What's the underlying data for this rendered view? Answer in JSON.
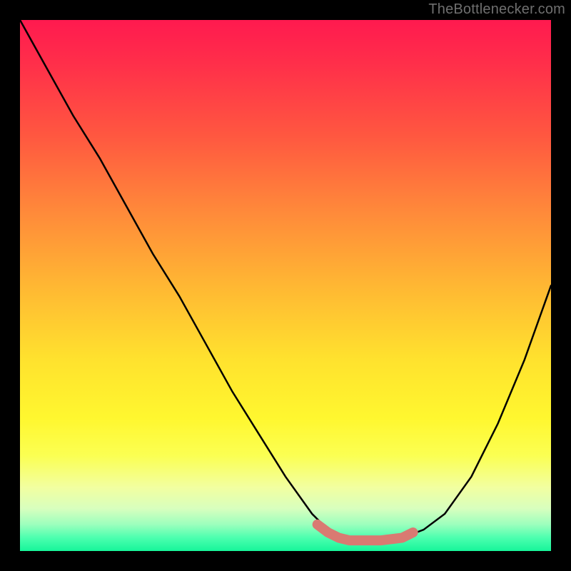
{
  "watermark": {
    "text": "TheBottlenecker.com"
  },
  "chart_data": {
    "type": "line",
    "title": "",
    "xlabel": "",
    "ylabel": "",
    "xlim": [
      0,
      100
    ],
    "ylim": [
      0,
      100
    ],
    "legend": false,
    "grid": false,
    "background_gradient": {
      "top_color": "#ff1a4f",
      "bottom_color": "#17f59a"
    },
    "series": [
      {
        "name": "main-curve",
        "color": "#000000",
        "x": [
          0,
          5,
          10,
          15,
          20,
          25,
          30,
          35,
          40,
          45,
          50,
          55,
          58,
          60,
          62,
          65,
          68,
          72,
          76,
          80,
          85,
          90,
          95,
          100
        ],
        "y": [
          100,
          91,
          82,
          74,
          65,
          56,
          48,
          39,
          30,
          22,
          14,
          7,
          4,
          2.5,
          2,
          2,
          2,
          2.5,
          4,
          7,
          14,
          24,
          36,
          50
        ]
      },
      {
        "name": "highlight-band",
        "color": "#d97a72",
        "x": [
          56,
          58,
          60,
          62,
          65,
          68,
          72,
          74
        ],
        "y": [
          5,
          3.5,
          2.5,
          2,
          2,
          2,
          2.5,
          3.5
        ]
      }
    ],
    "annotations": []
  }
}
